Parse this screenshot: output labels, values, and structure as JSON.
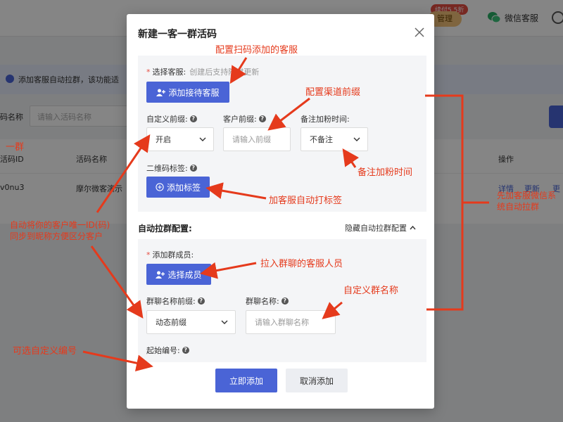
{
  "background": {
    "badge": "续付5.5折",
    "pill_label": "管理",
    "wechat_label": "微信客服",
    "notice": "添加客服自动拉群，该功能适",
    "filter_label": "码名称",
    "filter_placeholder": "请输入活码名称",
    "table": {
      "col_id": "活码ID",
      "col_name": "活码名称",
      "col_ops": "操作",
      "row_id": "v0nu3",
      "row_name": "摩尔微客演示",
      "link_detail": "详情",
      "link_update": "更新",
      "link_more": "更"
    }
  },
  "modal": {
    "title": "新建一客一群活码",
    "service": {
      "label": "选择客服:",
      "hint": "创建后支持随时更新",
      "button": "添加接待客服"
    },
    "custom_prefix": {
      "label": "自定义前缀:",
      "value": "开启"
    },
    "customer_prefix": {
      "label": "客户前缀:",
      "placeholder": "请输入前缀"
    },
    "remark_time": {
      "label": "备注加粉时间:",
      "value": "不备注"
    },
    "qr_tag": {
      "label": "二维码标签:",
      "button": "添加标签"
    },
    "auto_group": {
      "title": "自动拉群配置:",
      "toggle": "隐藏自动拉群配置"
    },
    "members": {
      "label": "添加群成员:",
      "button": "选择成员"
    },
    "group_prefix": {
      "label": "群聊名称前缀:",
      "value": "动态前缀"
    },
    "group_name": {
      "label": "群聊名称:",
      "placeholder": "请输入群聊名称"
    },
    "start_number": {
      "label": "起始编号:"
    },
    "confirm": "立即添加",
    "cancel": "取消添加"
  },
  "annotations": {
    "config_service": "配置扫码添加的客服",
    "config_channel": "配置渠道前缀",
    "remark_time": "备注加粉时间",
    "auto_tag": "加客服自动打标签",
    "add_members": "拉入群聊的客服人员",
    "group_name": "自定义群名称",
    "auto_sync": "自动将你的客户唯一ID(码)同步到昵称方便区分客户",
    "optional_number": "可选自定义编号",
    "right_note": "先加客服微信系统自动拉群",
    "left_fragment": "一群"
  },
  "colors": {
    "primary": "#4a64d6",
    "annotation": "#e53a1c",
    "required": "#e54d42"
  }
}
